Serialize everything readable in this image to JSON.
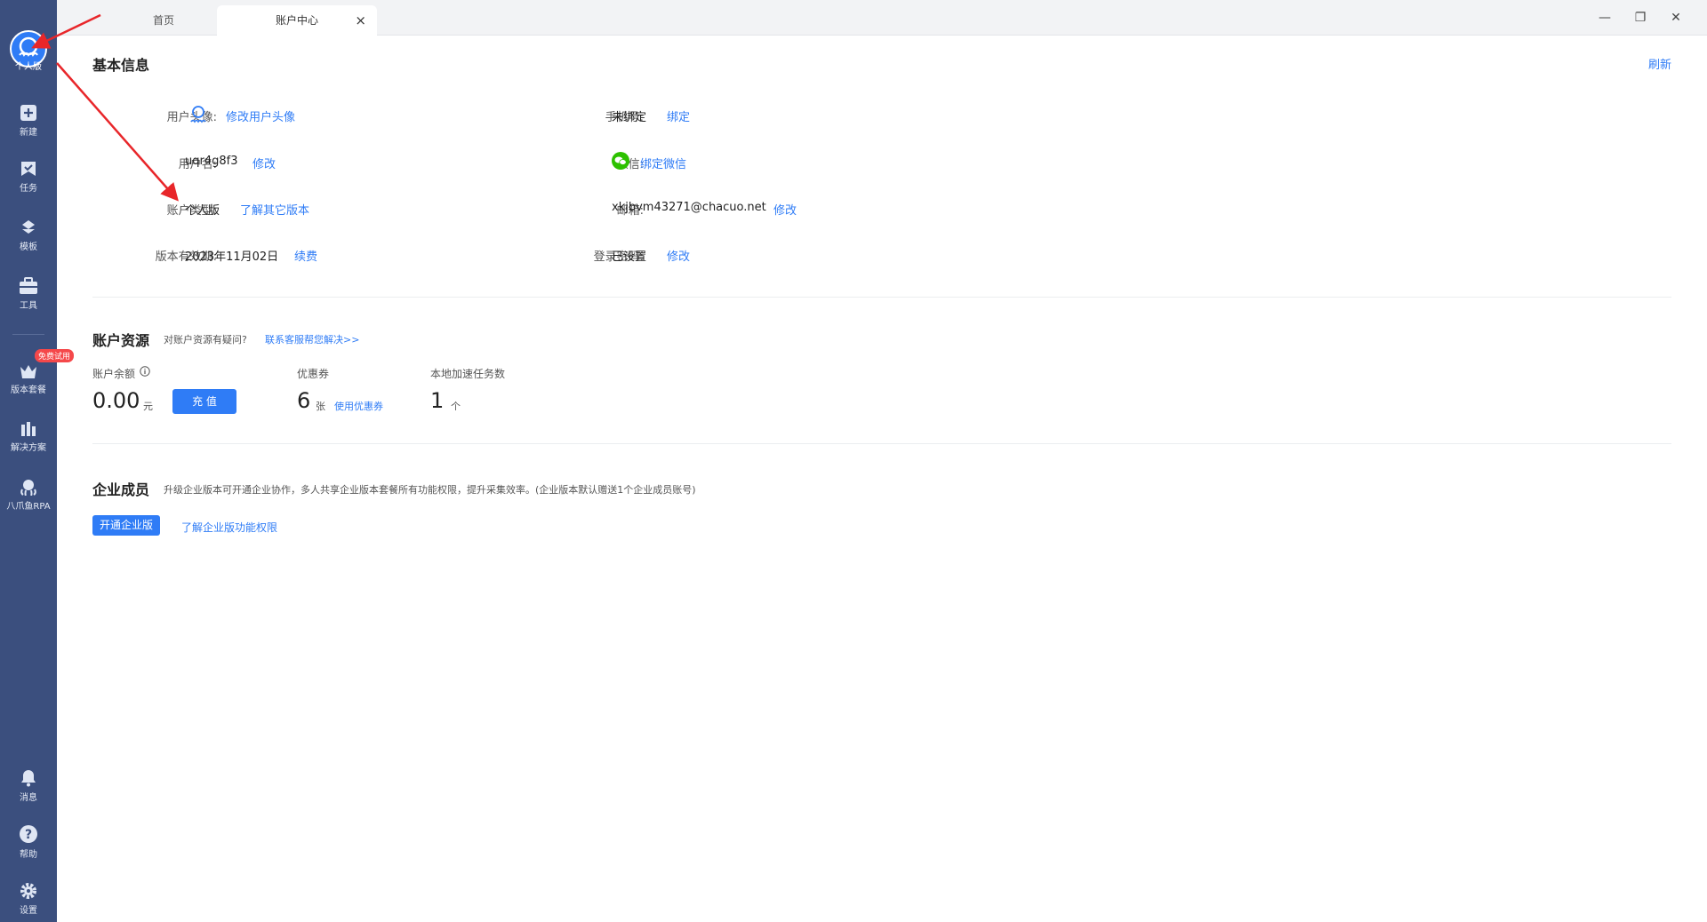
{
  "sidebar": {
    "logo_label": "个人版",
    "badge_free": "免费试用",
    "items": [
      {
        "label": "新建",
        "icon": "plus-square-icon"
      },
      {
        "label": "任务",
        "icon": "bookmark-flag-icon"
      },
      {
        "label": "模板",
        "icon": "template-icon"
      },
      {
        "label": "工具",
        "icon": "toolbox-icon"
      },
      {
        "label": "版本套餐",
        "icon": "crown-icon"
      },
      {
        "label": "解决方案",
        "icon": "solution-icon"
      },
      {
        "label": "八爪鱼RPA",
        "icon": "octopus-icon"
      },
      {
        "label": "消息",
        "icon": "bell-icon"
      },
      {
        "label": "帮助",
        "icon": "help-icon"
      },
      {
        "label": "设置",
        "icon": "gear-icon"
      }
    ]
  },
  "tabs": {
    "home": "首页",
    "active": "账户中心",
    "close": "×"
  },
  "window": {
    "minimize": "—",
    "restore": "❐",
    "close": "✕"
  },
  "basic": {
    "title": "基本信息",
    "refresh": "刷新",
    "avatar_label": "用户头像:",
    "avatar_link": "修改用户头像",
    "username_label": "用户名:",
    "username_value": "uqr4g8f3",
    "username_link": "修改",
    "type_label": "账户类型:",
    "type_value": "个人版",
    "type_link": "了解其它版本",
    "expiry_label": "版本有效期:",
    "expiry_value": "2023年11月02日",
    "expiry_link": "续费",
    "phone_label": "手机号:",
    "phone_value": "未绑定",
    "phone_link": "绑定",
    "wechat_label": "微信:",
    "wechat_link": "绑定微信",
    "email_label": "邮箱:",
    "email_value": "xkjbvm43271@chacuo.net",
    "email_link": "修改",
    "password_label": "登录密码:",
    "password_value": "已设置",
    "password_link": "修改"
  },
  "resources": {
    "title": "账户资源",
    "question": "对账户资源有疑问?",
    "contact_link": "联系客服帮您解决>>",
    "balance_label": "账户余额",
    "balance_value": "0.00",
    "balance_unit": "元",
    "recharge_button": "充 值",
    "coupon_label": "优惠券",
    "coupon_value": "6",
    "coupon_unit": "张",
    "coupon_link": "使用优惠券",
    "local_label": "本地加速任务数",
    "local_value": "1",
    "local_unit": "个"
  },
  "enterprise": {
    "title": "企业成员",
    "desc": "升级企业版本可开通企业协作，多人共享企业版本套餐所有功能权限，提升采集效率。(企业版本默认赠送1个企业成员账号)",
    "open_button": "开通企业版",
    "learn_link": "了解企业版功能权限"
  },
  "colors": {
    "sidebar": "#3b4f7e",
    "accent": "#2f7cf6",
    "annotation": "#e8262a",
    "wechat": "#2dc100"
  }
}
